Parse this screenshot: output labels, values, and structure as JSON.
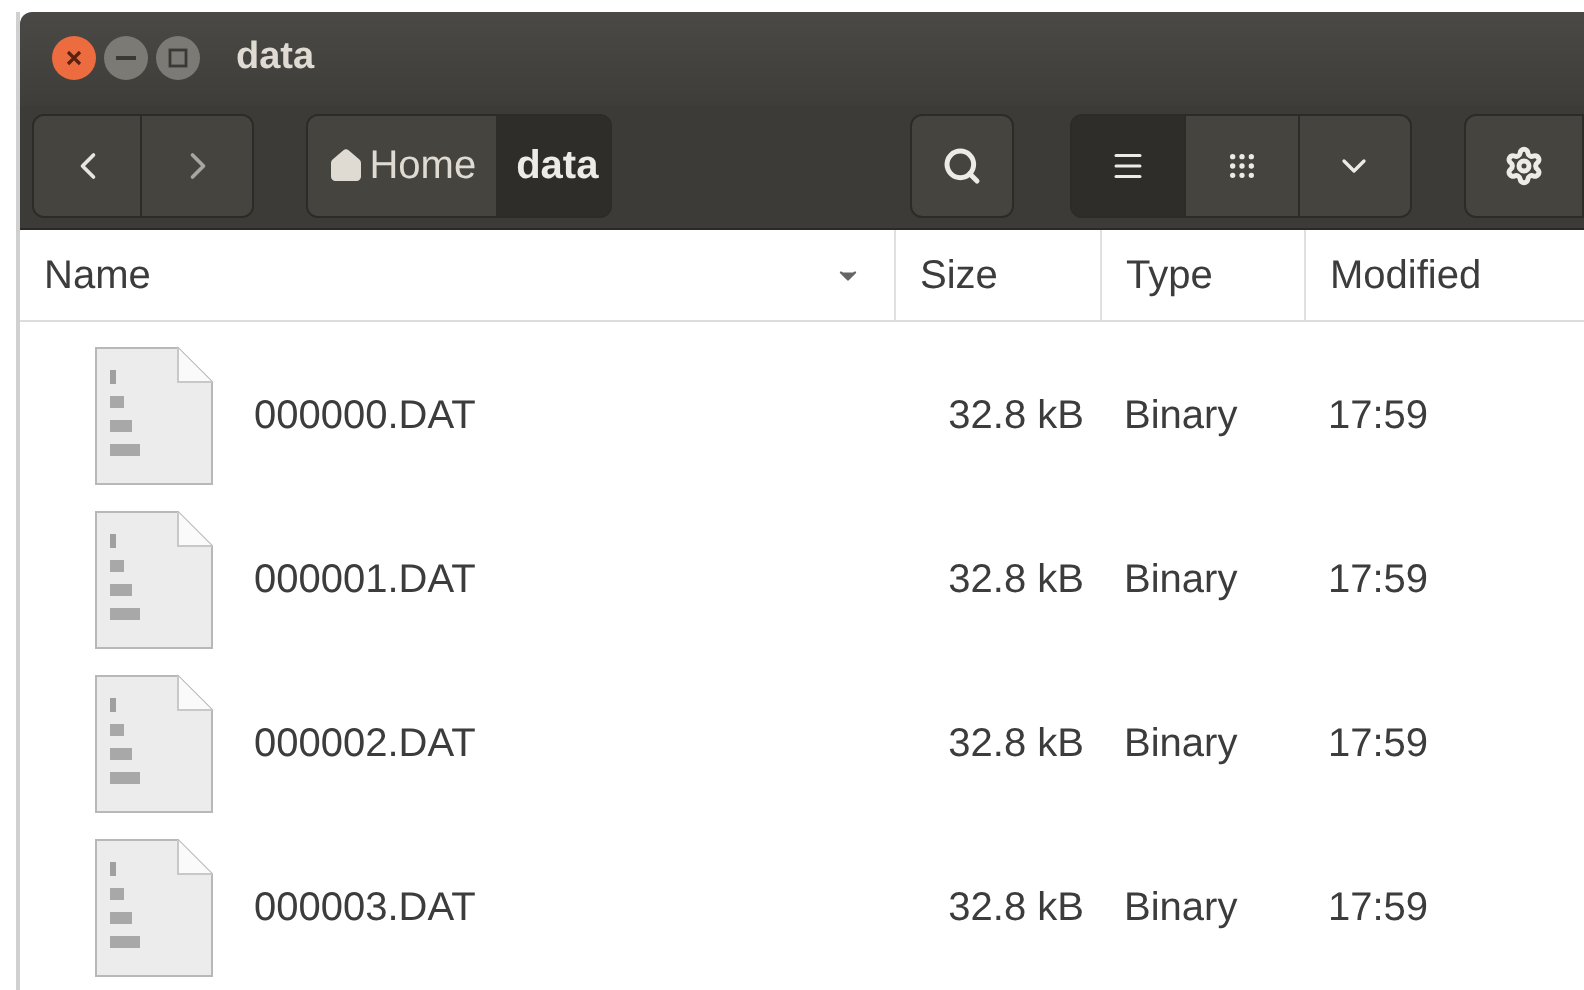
{
  "window": {
    "title": "data"
  },
  "breadcrumb": [
    {
      "label": "Home",
      "kind": "home",
      "selected": false
    },
    {
      "label": "data",
      "kind": "folder",
      "selected": true
    }
  ],
  "view_buttons": [
    {
      "kind": "list",
      "selected": true
    },
    {
      "kind": "grid",
      "selected": false
    },
    {
      "kind": "menu",
      "selected": false
    }
  ],
  "columns": [
    {
      "label": "Name",
      "sorted": true
    },
    {
      "label": "Size",
      "sorted": false
    },
    {
      "label": "Type",
      "sorted": false
    },
    {
      "label": "Modified",
      "sorted": false
    }
  ],
  "rows": [
    {
      "name": "000000.DAT",
      "size": "32.8 kB",
      "type": "Binary",
      "modified": "17:59"
    },
    {
      "name": "000001.DAT",
      "size": "32.8 kB",
      "type": "Binary",
      "modified": "17:59"
    },
    {
      "name": "000002.DAT",
      "size": "32.8 kB",
      "type": "Binary",
      "modified": "17:59"
    },
    {
      "name": "000003.DAT",
      "size": "32.8 kB",
      "type": "Binary",
      "modified": "17:59"
    }
  ]
}
